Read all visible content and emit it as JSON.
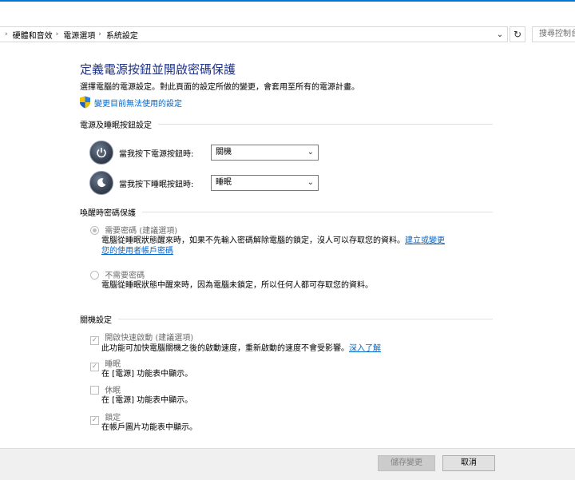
{
  "breadcrumb": {
    "items": [
      "硬體和音效",
      "電源選項",
      "系統設定"
    ],
    "search_placeholder": "搜尋控制台"
  },
  "page": {
    "title": "定義電源按鈕並開啟密碼保護",
    "subtitle": "選擇電腦的電源設定。對此頁面的設定所做的變更，會套用至所有的電源計畫。",
    "change_settings_link": "變更目前無法使用的設定"
  },
  "power_buttons": {
    "section_title": "電源及睡眠按鈕設定",
    "power_label": "當我按下電源按鈕時:",
    "power_value": "關機",
    "sleep_label": "當我按下睡眠按鈕時:",
    "sleep_value": "睡眠"
  },
  "wake_password": {
    "section_title": "喚醒時密碼保護",
    "require_label": "需要密碼 (建議選項)",
    "require_desc_1": "電腦從睡眠狀態醒來時，如果不先輸入密碼解除電腦的鎖定，沒人可以存取您的資料。",
    "require_link_1": "建立或變更",
    "require_link_2": "您的使用者帳戶密碼",
    "no_require_label": "不需要密碼",
    "no_require_desc": "電腦從睡眠狀態中醒來時，因為電腦未鎖定，所以任何人都可存取您的資料。"
  },
  "shutdown": {
    "section_title": "關機設定",
    "fast_startup_label": "開啟快速啟動 (建議選項)",
    "fast_startup_desc": "此功能可加快電腦關機之後的啟動速度，重新啟動的速度不會受影響。",
    "fast_startup_link": "深入了解",
    "sleep_label": "睡眠",
    "sleep_desc": "在 [電源] 功能表中顯示。",
    "hibernate_label": "休眠",
    "hibernate_desc": "在 [電源] 功能表中顯示。",
    "lock_label": "鎖定",
    "lock_desc": "在帳戶圖片功能表中顯示。"
  },
  "footer": {
    "save_label": "儲存變更",
    "cancel_label": "取消"
  }
}
